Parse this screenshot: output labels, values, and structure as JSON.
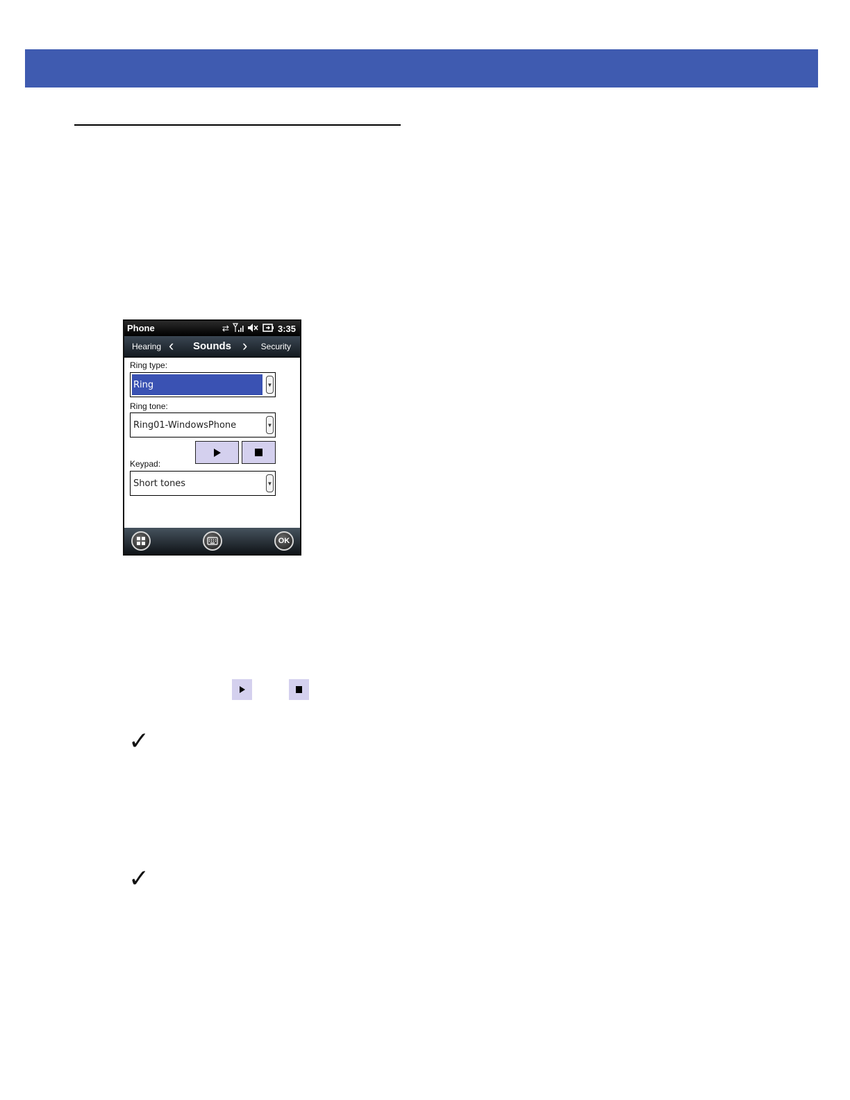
{
  "phone": {
    "status": {
      "title": "Phone",
      "time": "3:35"
    },
    "nav": {
      "prev": "Hearing",
      "title": "Sounds",
      "next": "Security"
    },
    "fields": {
      "ring_type_label": "Ring type:",
      "ring_type_value": "Ring",
      "ring_tone_label": "Ring tone:",
      "ring_tone_value": "Ring01-WindowsPhone",
      "keypad_label": "Keypad:",
      "keypad_value": "Short tones"
    },
    "softkeys": {
      "ok": "OK"
    }
  },
  "colors": {
    "header_bar": "#3f5bb0",
    "selection": "#3a52b3",
    "media_button": "#d4d0ee"
  }
}
